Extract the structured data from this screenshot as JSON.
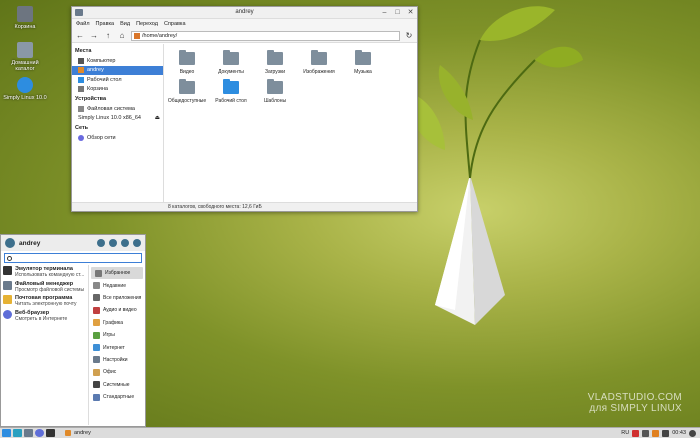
{
  "desktop": {
    "icons": [
      {
        "label": "Корзина",
        "icon": "trash-icon"
      },
      {
        "label": "Домашний каталог",
        "icon": "home-folder-icon"
      },
      {
        "label": "Simply Linux 10.0",
        "icon": "simply-linux-icon"
      }
    ],
    "watermark_line1": "VLADSTUDIO.COM",
    "watermark_line2": "для SIMPLY LINUX"
  },
  "file_manager": {
    "title": "andrey",
    "menu": [
      "Файл",
      "Правка",
      "Вид",
      "Переход",
      "Справка"
    ],
    "path": "/home/andrey/",
    "sidebar": {
      "places_header": "Места",
      "places": [
        "Компьютер",
        "andrey",
        "Рабочий стол",
        "Корзина"
      ],
      "devices_header": "Устройства",
      "devices": [
        "Файловая система",
        "Simply Linux 10.0 x86_64"
      ],
      "network_header": "Сеть",
      "network": [
        "Обзор сети"
      ]
    },
    "folders": [
      "Видео",
      "Документы",
      "Загрузки",
      "Изображения",
      "Музыка",
      "Общедоступные",
      "Рабочий стол",
      "Шаблоны"
    ],
    "status": "8 каталогов, свободного места: 12,6 ГиБ"
  },
  "start_menu": {
    "user": "andrey",
    "favorites": [
      {
        "title": "Эмулятор терминала",
        "desc": "Использовать командную ст..."
      },
      {
        "title": "Файловый менеджер",
        "desc": "Просмотр файловой системы"
      },
      {
        "title": "Почтовая программа",
        "desc": "Читать электронную почту"
      },
      {
        "title": "Веб-браузер",
        "desc": "Смотреть в Интернете"
      }
    ],
    "categories": [
      "Избранное",
      "Недавние",
      "Все приложения",
      "Аудио и видео",
      "Графика",
      "Игры",
      "Интернет",
      "Настройки",
      "Офис",
      "Системные",
      "Стандартные"
    ]
  },
  "taskbar": {
    "task_label": "andrey",
    "lang": "RU",
    "clock": "00:43"
  },
  "colors": {
    "accent": "#3d7fd6",
    "folder": "#7e8e9c"
  }
}
